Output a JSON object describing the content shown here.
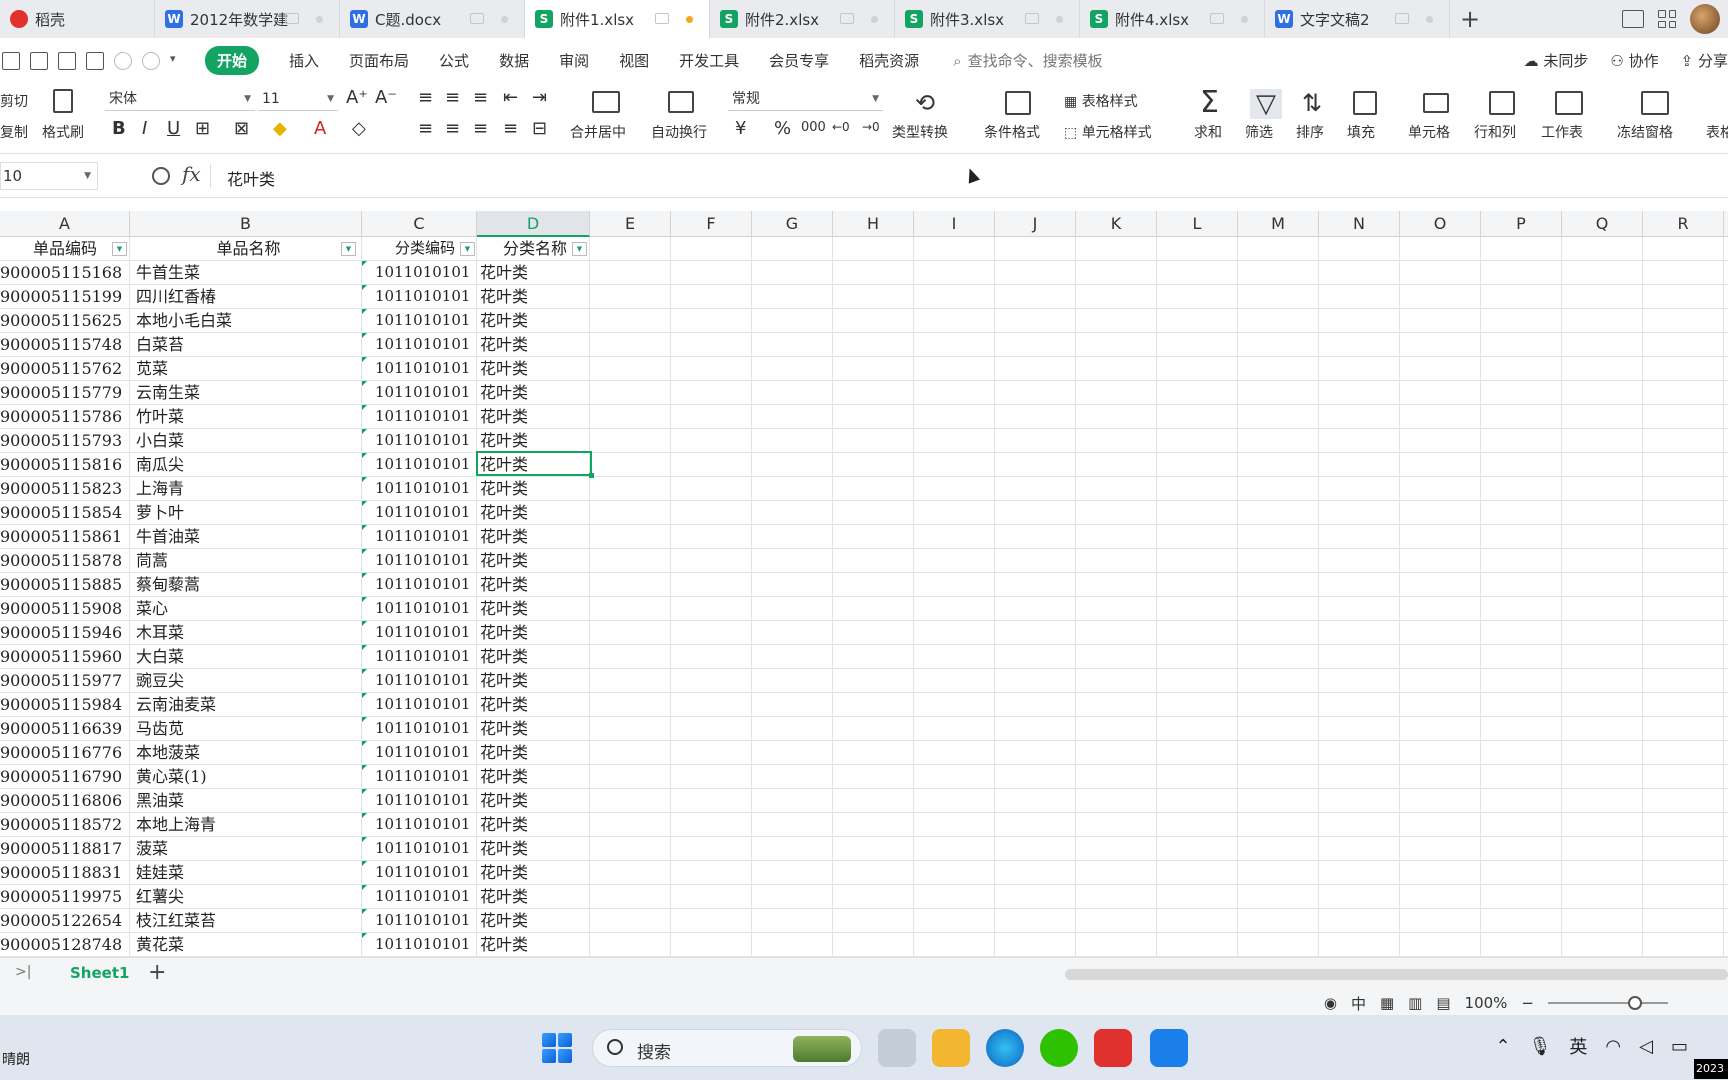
{
  "tabs": [
    {
      "label": "稻壳",
      "type": "d",
      "active": false
    },
    {
      "label": "2012年数学建",
      "type": "w",
      "active": false
    },
    {
      "label": "C题.docx",
      "type": "w",
      "active": false
    },
    {
      "label": "附件1.xlsx",
      "type": "s",
      "active": true
    },
    {
      "label": "附件2.xlsx",
      "type": "s",
      "active": false
    },
    {
      "label": "附件3.xlsx",
      "type": "s",
      "active": false
    },
    {
      "label": "附件4.xlsx",
      "type": "s",
      "active": false
    },
    {
      "label": "文字文稿2",
      "type": "w",
      "active": false
    }
  ],
  "tab_add": "+",
  "menu": {
    "items": [
      "开始",
      "插入",
      "页面布局",
      "公式",
      "数据",
      "审阅",
      "视图",
      "开发工具",
      "会员专享",
      "稻壳资源"
    ],
    "search_placeholder": "查找命令、搜索模板",
    "right": {
      "sync": "未同步",
      "collab": "协作",
      "share": "分享"
    }
  },
  "ribbon": {
    "cut": "剪切",
    "copy": "复制",
    "format_painter": "格式刷",
    "font_name": "宋体",
    "font_size": "11",
    "merge_center": "合并居中",
    "wrap_text": "自动换行",
    "number_format": "常规",
    "type_convert": "类型转换",
    "cond_format": "条件格式",
    "table_style": "表格样式",
    "cell_style": "单元格样式",
    "sum": "求和",
    "filter": "筛选",
    "sort": "排序",
    "fill": "填充",
    "cell": "单元格",
    "row_col": "行和列",
    "worksheet": "工作表",
    "freeze": "冻结窗格",
    "table_tools": "表格",
    "currency": "¥",
    "percent": "%",
    "thousands": "000"
  },
  "formula_bar": {
    "name_box": "10",
    "fx": "fx",
    "content": "花叶类"
  },
  "columns": [
    "A",
    "B",
    "C",
    "D",
    "E",
    "F",
    "G",
    "H",
    "I",
    "J",
    "K",
    "L",
    "M",
    "N",
    "O",
    "P",
    "Q",
    "R"
  ],
  "selected_column": "D",
  "table": {
    "headers": [
      "单品编码",
      "单品名称",
      "分类编码",
      "分类名称"
    ],
    "rows": [
      [
        "900005115168",
        "牛首生菜",
        "1011010101",
        "花叶类"
      ],
      [
        "900005115199",
        "四川红香椿",
        "1011010101",
        "花叶类"
      ],
      [
        "900005115625",
        "本地小毛白菜",
        "1011010101",
        "花叶类"
      ],
      [
        "900005115748",
        "白菜苔",
        "1011010101",
        "花叶类"
      ],
      [
        "900005115762",
        "苋菜",
        "1011010101",
        "花叶类"
      ],
      [
        "900005115779",
        "云南生菜",
        "1011010101",
        "花叶类"
      ],
      [
        "900005115786",
        "竹叶菜",
        "1011010101",
        "花叶类"
      ],
      [
        "900005115793",
        "小白菜",
        "1011010101",
        "花叶类"
      ],
      [
        "900005115816",
        "南瓜尖",
        "1011010101",
        "花叶类"
      ],
      [
        "900005115823",
        "上海青",
        "1011010101",
        "花叶类"
      ],
      [
        "900005115854",
        "萝卜叶",
        "1011010101",
        "花叶类"
      ],
      [
        "900005115861",
        "牛首油菜",
        "1011010101",
        "花叶类"
      ],
      [
        "900005115878",
        "茼蒿",
        "1011010101",
        "花叶类"
      ],
      [
        "900005115885",
        "蔡甸藜蒿",
        "1011010101",
        "花叶类"
      ],
      [
        "900005115908",
        "菜心",
        "1011010101",
        "花叶类"
      ],
      [
        "900005115946",
        "木耳菜",
        "1011010101",
        "花叶类"
      ],
      [
        "900005115960",
        "大白菜",
        "1011010101",
        "花叶类"
      ],
      [
        "900005115977",
        "豌豆尖",
        "1011010101",
        "花叶类"
      ],
      [
        "900005115984",
        "云南油麦菜",
        "1011010101",
        "花叶类"
      ],
      [
        "900005116639",
        "马齿苋",
        "1011010101",
        "花叶类"
      ],
      [
        "900005116776",
        "本地菠菜",
        "1011010101",
        "花叶类"
      ],
      [
        "900005116790",
        "黄心菜(1)",
        "1011010101",
        "花叶类"
      ],
      [
        "900005116806",
        "黑油菜",
        "1011010101",
        "花叶类"
      ],
      [
        "900005118572",
        "本地上海青",
        "1011010101",
        "花叶类"
      ],
      [
        "900005118817",
        "菠菜",
        "1011010101",
        "花叶类"
      ],
      [
        "900005118831",
        "娃娃菜",
        "1011010101",
        "花叶类"
      ],
      [
        "900005119975",
        "红薯尖",
        "1011010101",
        "花叶类"
      ],
      [
        "900005122654",
        "枝江红菜苔",
        "1011010101",
        "花叶类"
      ],
      [
        "900005128748",
        "黄花菜",
        "1011010101",
        "花叶类"
      ]
    ]
  },
  "sheets": [
    "Sheet1"
  ],
  "status": {
    "zoom": "100%",
    "input_mode": "中"
  },
  "taskbar": {
    "weather": "晴朗",
    "search_label": "搜索",
    "ime": "英",
    "clock": "2023"
  },
  "colors": {
    "accent": "#13a463",
    "word": "#2f6fe4",
    "docer": "#e0312f"
  }
}
